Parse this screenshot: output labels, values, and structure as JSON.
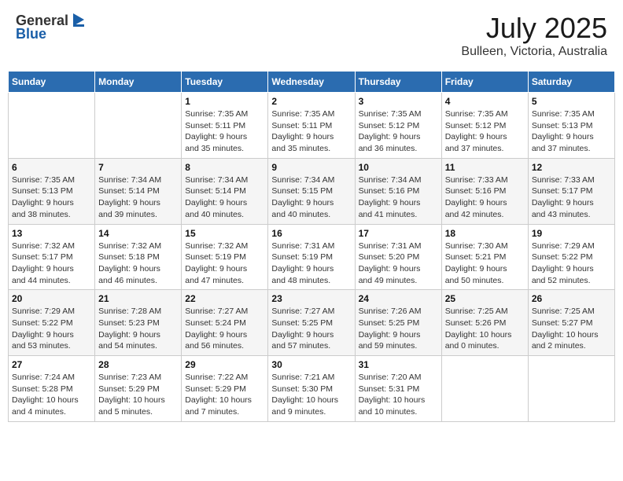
{
  "header": {
    "logo_line1": "General",
    "logo_line2": "Blue",
    "month": "July 2025",
    "location": "Bulleen, Victoria, Australia"
  },
  "weekdays": [
    "Sunday",
    "Monday",
    "Tuesday",
    "Wednesday",
    "Thursday",
    "Friday",
    "Saturday"
  ],
  "weeks": [
    [
      {
        "day": "",
        "info": ""
      },
      {
        "day": "",
        "info": ""
      },
      {
        "day": "1",
        "info": "Sunrise: 7:35 AM\nSunset: 5:11 PM\nDaylight: 9 hours\nand 35 minutes."
      },
      {
        "day": "2",
        "info": "Sunrise: 7:35 AM\nSunset: 5:11 PM\nDaylight: 9 hours\nand 35 minutes."
      },
      {
        "day": "3",
        "info": "Sunrise: 7:35 AM\nSunset: 5:12 PM\nDaylight: 9 hours\nand 36 minutes."
      },
      {
        "day": "4",
        "info": "Sunrise: 7:35 AM\nSunset: 5:12 PM\nDaylight: 9 hours\nand 37 minutes."
      },
      {
        "day": "5",
        "info": "Sunrise: 7:35 AM\nSunset: 5:13 PM\nDaylight: 9 hours\nand 37 minutes."
      }
    ],
    [
      {
        "day": "6",
        "info": "Sunrise: 7:35 AM\nSunset: 5:13 PM\nDaylight: 9 hours\nand 38 minutes."
      },
      {
        "day": "7",
        "info": "Sunrise: 7:34 AM\nSunset: 5:14 PM\nDaylight: 9 hours\nand 39 minutes."
      },
      {
        "day": "8",
        "info": "Sunrise: 7:34 AM\nSunset: 5:14 PM\nDaylight: 9 hours\nand 40 minutes."
      },
      {
        "day": "9",
        "info": "Sunrise: 7:34 AM\nSunset: 5:15 PM\nDaylight: 9 hours\nand 40 minutes."
      },
      {
        "day": "10",
        "info": "Sunrise: 7:34 AM\nSunset: 5:16 PM\nDaylight: 9 hours\nand 41 minutes."
      },
      {
        "day": "11",
        "info": "Sunrise: 7:33 AM\nSunset: 5:16 PM\nDaylight: 9 hours\nand 42 minutes."
      },
      {
        "day": "12",
        "info": "Sunrise: 7:33 AM\nSunset: 5:17 PM\nDaylight: 9 hours\nand 43 minutes."
      }
    ],
    [
      {
        "day": "13",
        "info": "Sunrise: 7:32 AM\nSunset: 5:17 PM\nDaylight: 9 hours\nand 44 minutes."
      },
      {
        "day": "14",
        "info": "Sunrise: 7:32 AM\nSunset: 5:18 PM\nDaylight: 9 hours\nand 46 minutes."
      },
      {
        "day": "15",
        "info": "Sunrise: 7:32 AM\nSunset: 5:19 PM\nDaylight: 9 hours\nand 47 minutes."
      },
      {
        "day": "16",
        "info": "Sunrise: 7:31 AM\nSunset: 5:19 PM\nDaylight: 9 hours\nand 48 minutes."
      },
      {
        "day": "17",
        "info": "Sunrise: 7:31 AM\nSunset: 5:20 PM\nDaylight: 9 hours\nand 49 minutes."
      },
      {
        "day": "18",
        "info": "Sunrise: 7:30 AM\nSunset: 5:21 PM\nDaylight: 9 hours\nand 50 minutes."
      },
      {
        "day": "19",
        "info": "Sunrise: 7:29 AM\nSunset: 5:22 PM\nDaylight: 9 hours\nand 52 minutes."
      }
    ],
    [
      {
        "day": "20",
        "info": "Sunrise: 7:29 AM\nSunset: 5:22 PM\nDaylight: 9 hours\nand 53 minutes."
      },
      {
        "day": "21",
        "info": "Sunrise: 7:28 AM\nSunset: 5:23 PM\nDaylight: 9 hours\nand 54 minutes."
      },
      {
        "day": "22",
        "info": "Sunrise: 7:27 AM\nSunset: 5:24 PM\nDaylight: 9 hours\nand 56 minutes."
      },
      {
        "day": "23",
        "info": "Sunrise: 7:27 AM\nSunset: 5:25 PM\nDaylight: 9 hours\nand 57 minutes."
      },
      {
        "day": "24",
        "info": "Sunrise: 7:26 AM\nSunset: 5:25 PM\nDaylight: 9 hours\nand 59 minutes."
      },
      {
        "day": "25",
        "info": "Sunrise: 7:25 AM\nSunset: 5:26 PM\nDaylight: 10 hours\nand 0 minutes."
      },
      {
        "day": "26",
        "info": "Sunrise: 7:25 AM\nSunset: 5:27 PM\nDaylight: 10 hours\nand 2 minutes."
      }
    ],
    [
      {
        "day": "27",
        "info": "Sunrise: 7:24 AM\nSunset: 5:28 PM\nDaylight: 10 hours\nand 4 minutes."
      },
      {
        "day": "28",
        "info": "Sunrise: 7:23 AM\nSunset: 5:29 PM\nDaylight: 10 hours\nand 5 minutes."
      },
      {
        "day": "29",
        "info": "Sunrise: 7:22 AM\nSunset: 5:29 PM\nDaylight: 10 hours\nand 7 minutes."
      },
      {
        "day": "30",
        "info": "Sunrise: 7:21 AM\nSunset: 5:30 PM\nDaylight: 10 hours\nand 9 minutes."
      },
      {
        "day": "31",
        "info": "Sunrise: 7:20 AM\nSunset: 5:31 PM\nDaylight: 10 hours\nand 10 minutes."
      },
      {
        "day": "",
        "info": ""
      },
      {
        "day": "",
        "info": ""
      }
    ]
  ]
}
